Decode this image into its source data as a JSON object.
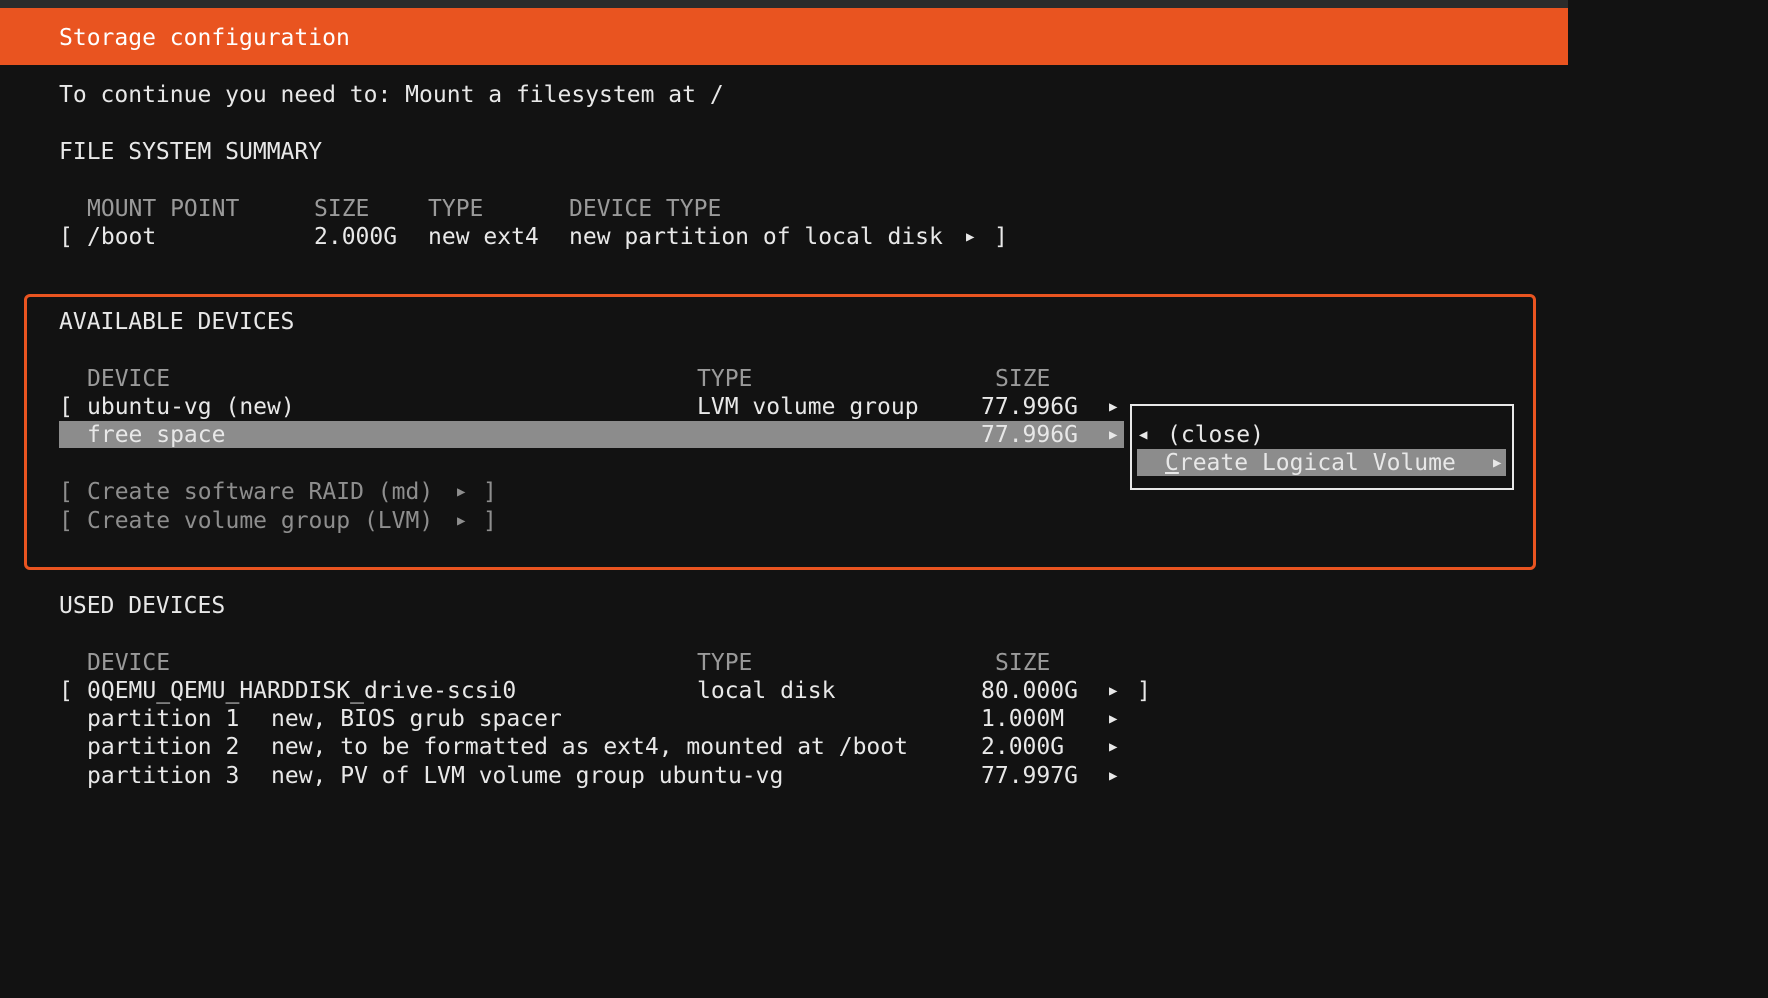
{
  "title": "Storage configuration",
  "instruction": "To continue you need to: Mount a filesystem at /",
  "fs_summary": {
    "heading": "FILE SYSTEM SUMMARY",
    "columns": [
      "MOUNT POINT",
      "SIZE",
      "TYPE",
      "DEVICE TYPE"
    ],
    "rows": [
      {
        "open": "[",
        "mount": "/boot",
        "size": "2.000G",
        "type": "new ext4",
        "device_type": "new partition of local disk",
        "arrow": "▶",
        "close": "]"
      }
    ]
  },
  "available": {
    "heading": "AVAILABLE DEVICES",
    "columns": [
      "DEVICE",
      "TYPE",
      "SIZE"
    ],
    "rows": [
      {
        "open": "[",
        "device": "ubuntu-vg (new)",
        "type": "LVM volume group",
        "size": "77.996G",
        "arrow": "▶"
      },
      {
        "device": "free space",
        "size": "77.996G",
        "arrow": "▶",
        "selected": true
      }
    ],
    "actions": [
      {
        "open": "[",
        "label": "Create software RAID (md)",
        "arrow": "▶",
        "close": "]"
      },
      {
        "open": "[",
        "label": "Create volume group (LVM)",
        "arrow": "▶",
        "close": "]"
      }
    ],
    "popup": {
      "close_arrow": "◀",
      "close_label": "(close)",
      "item_first": "C",
      "item_rest": "reate Logical Volume",
      "item_arrow": "▶"
    }
  },
  "used": {
    "heading": "USED DEVICES",
    "columns": [
      "DEVICE",
      "TYPE",
      "SIZE"
    ],
    "disk": {
      "open": "[",
      "device": "0QEMU_QEMU_HARDDISK_drive-scsi0",
      "type": "local disk",
      "size": "80.000G",
      "arrow": "▶",
      "close": "]"
    },
    "partitions": [
      {
        "name": "partition 1",
        "desc": "new, BIOS grub spacer",
        "size": "1.000M",
        "arrow": "▶"
      },
      {
        "name": "partition 2",
        "desc": "new, to be formatted as ext4, mounted at /boot",
        "size": "2.000G",
        "arrow": "▶"
      },
      {
        "name": "partition 3",
        "desc": "new, PV of LVM volume group ubuntu-vg",
        "size": "77.997G",
        "arrow": "▶"
      }
    ]
  },
  "colors": {
    "accent": "#e95420",
    "background": "#121212",
    "selection": "#8c8c8c",
    "text": "#e8e8e8"
  }
}
